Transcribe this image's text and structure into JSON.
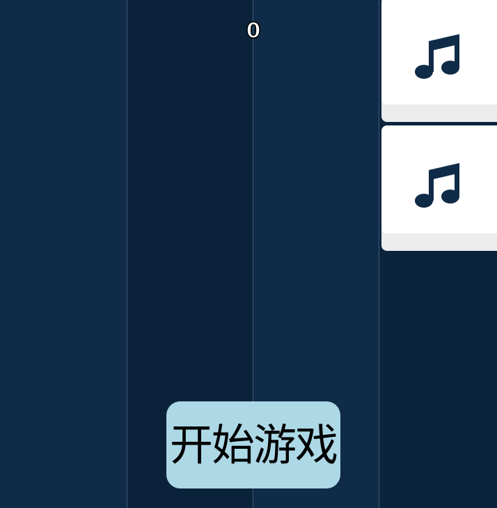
{
  "game": {
    "score": "0",
    "start_button_label": "开始游戏"
  },
  "tiles": [
    {
      "icon": "music-note-icon"
    },
    {
      "icon": "music-note-icon"
    }
  ],
  "colors": {
    "background": "#0a243d",
    "lane_light": "#0f2b48",
    "lane_dark": "#0a233b",
    "lane_divider": "#3e5a73",
    "tile_face": "#ffffff",
    "tile_shadow": "#ececec",
    "note_color": "#0f2b48",
    "start_button": "#add8e6"
  }
}
